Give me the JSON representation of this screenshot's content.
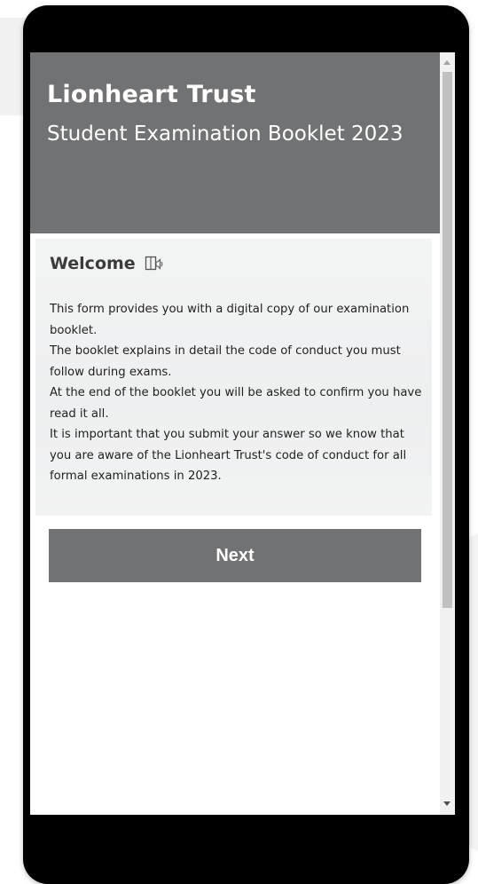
{
  "header": {
    "brand": "Lionheart Trust",
    "subtitle": "Student Examination Booklet 2023"
  },
  "welcome": {
    "title": "Welcome",
    "icon": "immersive-reader-icon",
    "paragraphs": [
      "This form provides you with a digital copy of our examination booklet.",
      "The booklet explains in detail the code of conduct you must follow during exams.",
      "At the end of the booklet you will be asked to confirm you have read it all.",
      "It is important that you submit your answer so we know that you are aware of the Lionheart Trust's code of conduct for all formal examinations in 2023."
    ]
  },
  "actions": {
    "next_label": "Next"
  },
  "colors": {
    "header_bg": "#717273",
    "button_bg": "#717273",
    "frame": "#000000"
  }
}
